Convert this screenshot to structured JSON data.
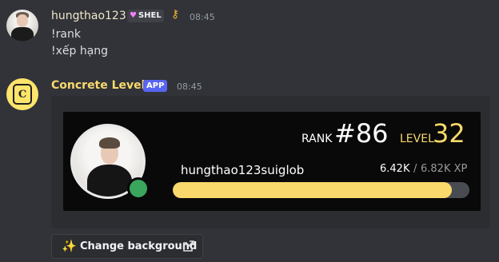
{
  "messages": [
    {
      "author": "hungthao123",
      "tag": "SHEL",
      "time": "08:45",
      "lines": [
        "!rank",
        "!xếp hạng"
      ]
    }
  ],
  "bot": {
    "name": "Concrete Levels",
    "badge": "APP",
    "time": "08:45",
    "avatar_letter": "C"
  },
  "rank_card": {
    "rank_label": "RANK",
    "rank_value": "#86",
    "level_label": "LEVEL",
    "level_value": "32",
    "username": "hungthao123suiglob",
    "xp_current": "6.42K",
    "xp_separator": "/",
    "xp_total": "6.82K XP",
    "progress_fraction": 0.941,
    "status": "online",
    "colors": {
      "accent": "#f9d96c",
      "status": "#3ba55d",
      "track": "#484b51"
    }
  },
  "action_button": {
    "label": "Change background",
    "icon_left": "sparkles-icon",
    "icon_right": "external-link-icon"
  }
}
